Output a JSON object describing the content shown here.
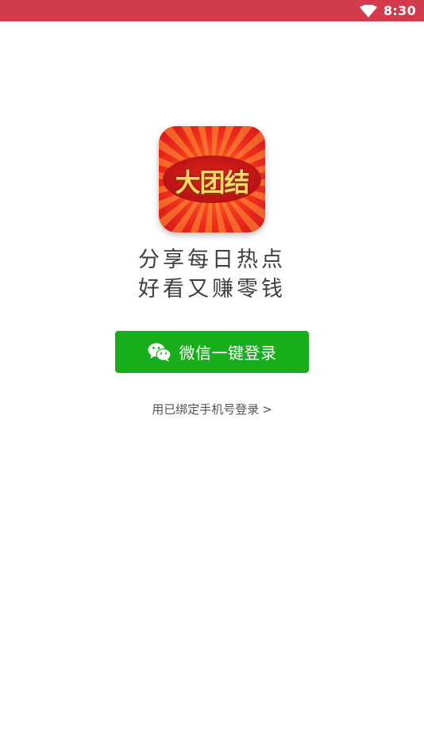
{
  "status_bar": {
    "time": "8:30",
    "icons": [
      "wifi-icon"
    ],
    "background": "#d33a4c"
  },
  "app_icon": {
    "logo_text": "大团结",
    "colors": {
      "background": "#e8231b",
      "rays": "#ff6a2e",
      "text": "#ffd86a"
    }
  },
  "slogan": {
    "line1": "分享每日热点",
    "line2": "好看又赚零钱"
  },
  "login": {
    "wechat_button_label": "微信一键登录",
    "wechat_icon": "wechat-icon",
    "button_color": "#18ad1b",
    "phone_login_label": "用已绑定手机号登录",
    "phone_login_arrow": ">"
  }
}
